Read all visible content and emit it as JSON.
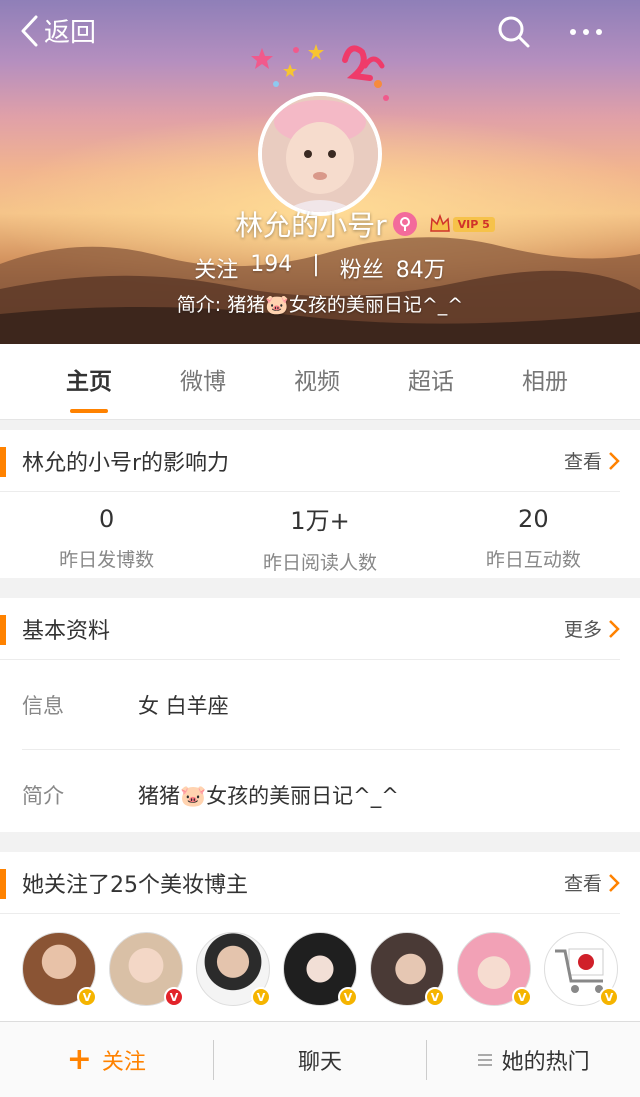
{
  "header": {
    "back_label": "返回",
    "nickname": "林允的小号r",
    "vip_label": "VIP 5",
    "following_label": "关注",
    "following_count": "194",
    "separator": "|",
    "followers_label": "粉丝",
    "followers_count": "84万",
    "bio": "简介: 猪猪🐷女孩的美丽日记^_^"
  },
  "tabs": [
    "主页",
    "微博",
    "视频",
    "超话",
    "相册"
  ],
  "influence": {
    "title": "林允的小号r的影响力",
    "link": "查看",
    "metrics": [
      {
        "value": "0",
        "label": "昨日发博数"
      },
      {
        "value": "1万+",
        "label": "昨日阅读人数"
      },
      {
        "value": "20",
        "label": "昨日互动数"
      }
    ]
  },
  "basic_info": {
    "title": "基本资料",
    "link": "更多",
    "rows": [
      {
        "key": "信息",
        "value": "女 白羊座"
      },
      {
        "key": "简介",
        "value": "猪猪🐷女孩的美丽日记^_^"
      }
    ]
  },
  "following_bloggers": {
    "title": "她关注了25个美妆博主",
    "link": "查看"
  },
  "bottom_bar": {
    "follow": "关注",
    "chat": "聊天",
    "hot": "她的热门"
  },
  "colors": {
    "accent": "#ff8200"
  }
}
